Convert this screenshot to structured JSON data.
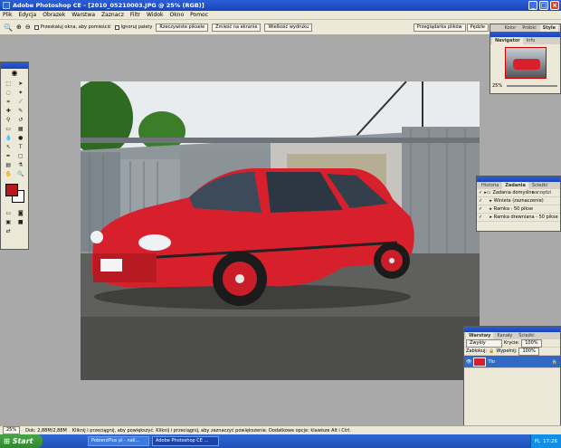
{
  "window": {
    "title": "Adobe Photoshop CE - [2010_05210003.JPG @ 25% (RGB)]",
    "controls": [
      "_",
      "□",
      "×"
    ]
  },
  "menu": [
    "Plik",
    "Edycja",
    "Obrazek",
    "Warstwa",
    "Zaznacz",
    "Filtr",
    "Widok",
    "Okno",
    "Pomoc"
  ],
  "options": {
    "checkbox1": "Przeskaluj okna, aby pomieścić",
    "checkbox2": "Ignoruj palety",
    "buttons": [
      "Rzeczywiste piksele",
      "Zmieść na ekranie",
      "Wielkość wydruku"
    ],
    "tabs": [
      "Przeglądarka plików",
      "Pędzle"
    ]
  },
  "navigator": {
    "tabs": [
      "Kolor",
      "Próbki",
      "Style"
    ],
    "tabs2": [
      "Navigator",
      "Info"
    ],
    "zoom": "25%"
  },
  "history": {
    "tabs": [
      "Historia",
      "Zadania",
      "Ścieżki narzędzi"
    ],
    "items": [
      "Zadania domyślne",
      "Winieta (zaznaczenie)",
      "Ramka - 50 pikse",
      "Ramka drewniana - 50 pikse"
    ]
  },
  "layers": {
    "tabs": [
      "Warstwy",
      "Kanały",
      "Ścieżki"
    ],
    "blend": "Zwykły",
    "opacity_label": "Krycie:",
    "opacity": "100%",
    "lock_label": "Zablokuj:",
    "fill_label": "Wypełnij:",
    "fill": "100%",
    "layer_name": "Tło"
  },
  "status": {
    "zoom": "25%",
    "doc": "Dok: 2,88M/2,88M",
    "hint": "Kliknij i przeciągnij, aby powiększyć. Kliknij i przeciągnij, aby zaznaczyć powiększenie. Dodatkowe opcje: klawisze Alt i Ctrl."
  },
  "taskbar": {
    "start": "Start",
    "tasks": [
      "PobierzPlus pl - nali...",
      "Adobe Photoshop CE ..."
    ],
    "language": "PL",
    "time": "17:26"
  },
  "colors": {
    "foreground": "#b41a1a",
    "background": "#ffffff"
  }
}
